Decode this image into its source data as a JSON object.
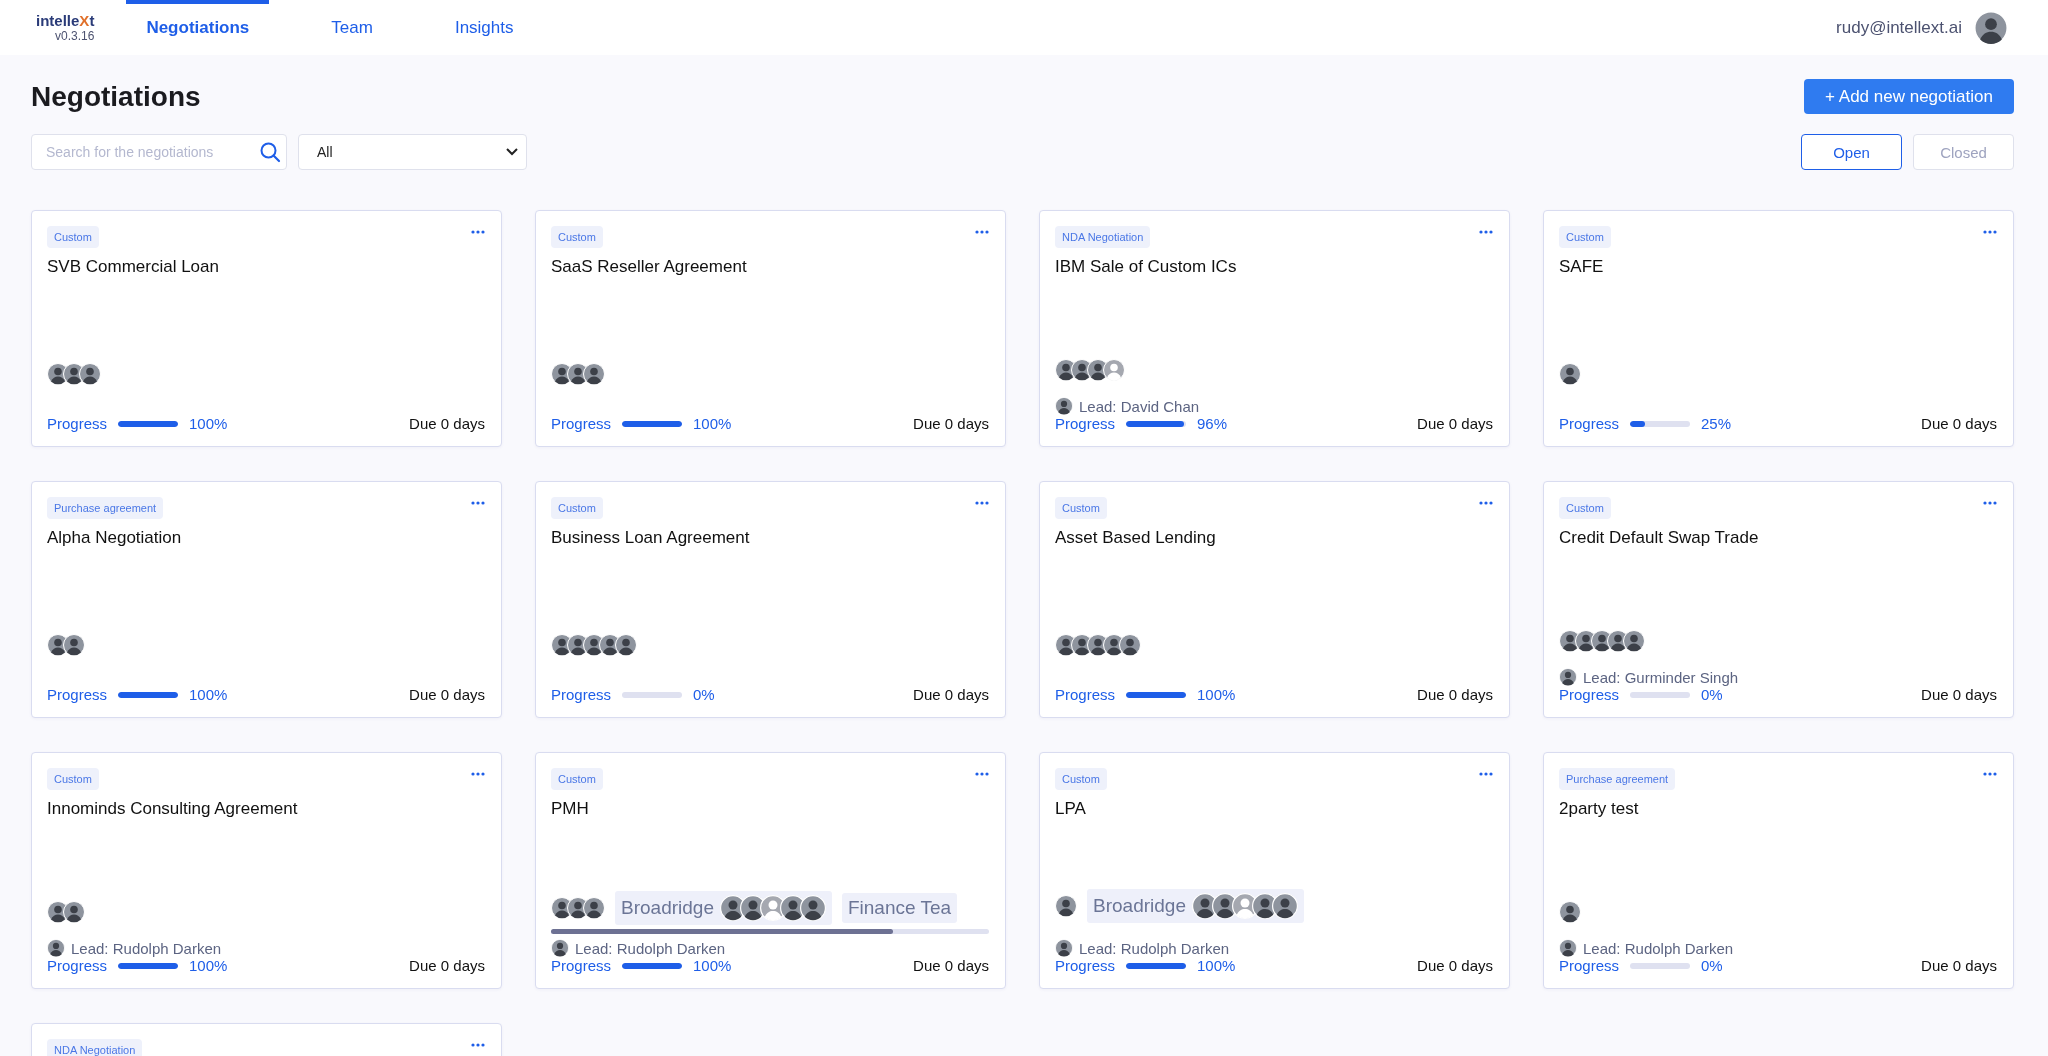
{
  "header": {
    "logo": {
      "before": "intelle",
      "mark": "X",
      "after": "t"
    },
    "version": "v0.3.16",
    "tabs": [
      {
        "label": "Negotiations",
        "selected": true
      },
      {
        "label": "Team",
        "selected": false
      },
      {
        "label": "Insights",
        "selected": false
      }
    ],
    "user": "rudy@intellext.ai"
  },
  "page": {
    "title": "Negotiations",
    "add_button": "+ Add new negotiation",
    "search": {
      "placeholder": "Search for the negotiations"
    },
    "filter": {
      "value": "All"
    },
    "status_toggle": [
      {
        "label": "Open",
        "selected": true
      },
      {
        "label": "Closed",
        "selected": false
      }
    ]
  },
  "cards": [
    {
      "tag": "Custom",
      "title": "SVB Commercial Loan",
      "avatars": [
        {
          "kind": "photo"
        },
        {
          "kind": "photo"
        },
        {
          "kind": "photo"
        }
      ],
      "progress_label": "Progress",
      "level": 1,
      "percent": "100%",
      "due": "Due 0 days"
    },
    {
      "tag": "Custom",
      "title": "SaaS Reseller Agreement",
      "avatars": [
        {
          "kind": "photo"
        },
        {
          "kind": "photo"
        },
        {
          "kind": "photo"
        }
      ],
      "progress_label": "Progress",
      "level": 1,
      "percent": "100%",
      "due": "Due 0 days"
    },
    {
      "tag": "NDA Negotiation",
      "title": "IBM Sale of Custom ICs",
      "avatars": [
        {
          "kind": "photo"
        },
        {
          "kind": "photo"
        },
        {
          "kind": "photo"
        },
        {
          "kind": "placeholder"
        }
      ],
      "lead": "Lead: David Chan",
      "progress_label": "Progress",
      "level": 0.96,
      "percent": "96%",
      "due": "Due 0 days"
    },
    {
      "tag": "Custom",
      "title": "SAFE",
      "avatars": [
        {
          "kind": "photo"
        }
      ],
      "progress_label": "Progress",
      "level": 0.25,
      "percent": "25%",
      "due": "Due 0 days"
    },
    {
      "tag": "Purchase agreement",
      "title": "Alpha Negotiation",
      "avatars": [
        {
          "kind": "photo"
        },
        {
          "kind": "photo"
        }
      ],
      "progress_label": "Progress",
      "level": 1,
      "percent": "100%",
      "due": "Due 0 days"
    },
    {
      "tag": "Custom",
      "title": "Business Loan Agreement",
      "avatars": [
        {
          "kind": "photo"
        },
        {
          "kind": "photo"
        },
        {
          "kind": "photo"
        },
        {
          "kind": "photo"
        },
        {
          "kind": "photo"
        }
      ],
      "progress_label": "Progress",
      "level": 0,
      "percent": "0%",
      "due": "Due 0 days"
    },
    {
      "tag": "Custom",
      "title": "Asset Based Lending",
      "avatars": [
        {
          "kind": "photo"
        },
        {
          "kind": "photo"
        },
        {
          "kind": "photo"
        },
        {
          "kind": "photo"
        },
        {
          "kind": "photo"
        }
      ],
      "progress_label": "Progress",
      "level": 1,
      "percent": "100%",
      "due": "Due 0 days"
    },
    {
      "tag": "Custom",
      "title": "Credit Default Swap Trade",
      "avatars": [
        {
          "kind": "photo"
        },
        {
          "kind": "photo"
        },
        {
          "kind": "photo"
        },
        {
          "kind": "photo"
        },
        {
          "kind": "photo"
        }
      ],
      "lead": "Lead: Gurminder Singh",
      "progress_label": "Progress",
      "level": 0,
      "percent": "0%",
      "due": "Due 0 days"
    },
    {
      "tag": "Custom",
      "title": "Innominds Consulting Agreement",
      "avatars": [
        {
          "kind": "photo"
        },
        {
          "kind": "photo"
        }
      ],
      "lead": "Lead: Rudolph Darken",
      "progress_label": "Progress",
      "level": 1,
      "percent": "100%",
      "due": "Due 0 days"
    },
    {
      "tag": "Custom",
      "title": "PMH",
      "avatars": [
        {
          "kind": "photo"
        },
        {
          "kind": "photo"
        },
        {
          "kind": "photo"
        }
      ],
      "teams": [
        {
          "name": "Broadridge",
          "avatars": [
            {
              "kind": "photo"
            },
            {
              "kind": "photo"
            },
            {
              "kind": "placeholder"
            },
            {
              "kind": "photo"
            },
            {
              "kind": "photo"
            }
          ]
        },
        {
          "name": "Finance Tea"
        }
      ],
      "lead": "Lead: Rudolph Darken",
      "progress_label": "Progress",
      "level": 1,
      "percent": "100%",
      "due": "Due 0 days"
    },
    {
      "tag": "Custom",
      "title": "LPA",
      "avatars": [
        {
          "kind": "photo"
        }
      ],
      "teams": [
        {
          "name": "Broadridge",
          "avatars": [
            {
              "kind": "photo"
            },
            {
              "kind": "photo"
            },
            {
              "kind": "placeholder"
            },
            {
              "kind": "photo"
            },
            {
              "kind": "photo"
            }
          ]
        }
      ],
      "lead": "Lead: Rudolph Darken",
      "progress_label": "Progress",
      "level": 1,
      "percent": "100%",
      "due": "Due 0 days"
    },
    {
      "tag": "Purchase agreement",
      "title": "2party test",
      "avatars": [
        {
          "kind": "photo"
        }
      ],
      "lead": "Lead: Rudolph Darken",
      "progress_label": "Progress",
      "level": 0,
      "percent": "0%",
      "due": "Due 0 days"
    },
    {
      "tag": "NDA Negotiation"
    }
  ]
}
